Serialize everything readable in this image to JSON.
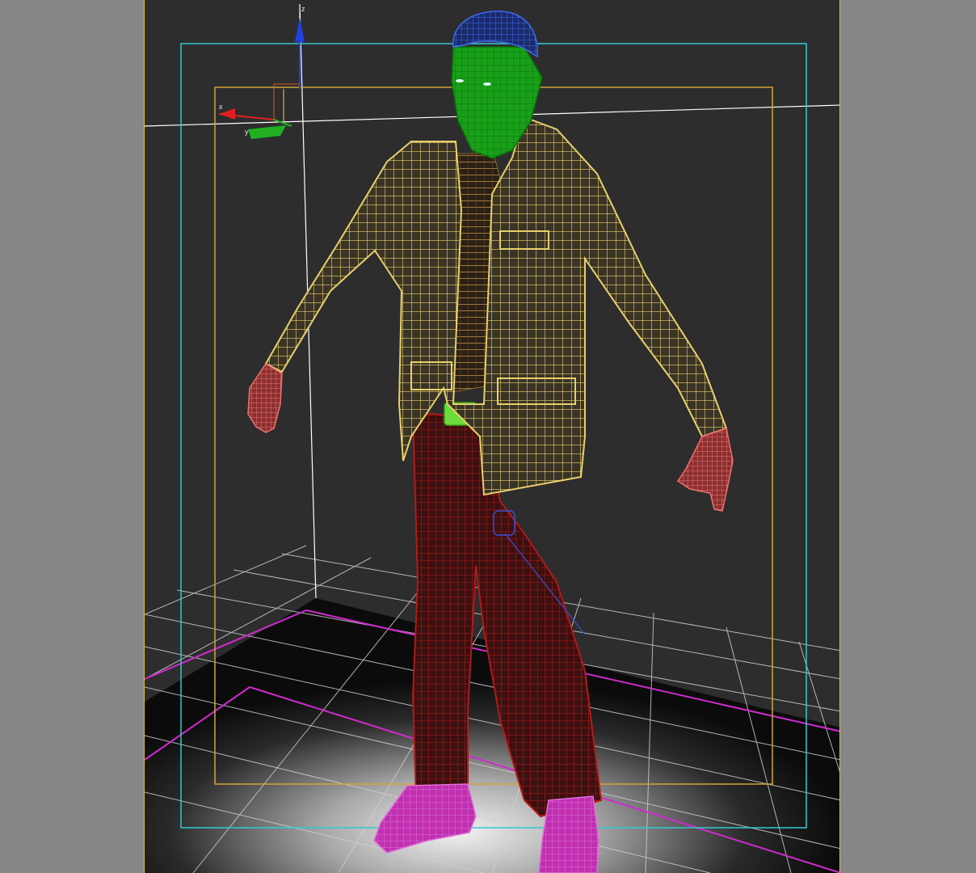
{
  "viewport": {
    "type": "perspective-3d-viewport",
    "content": "character-mesh-wireframe",
    "colors": {
      "background": "#2d2d2d",
      "side_panels": "#878787",
      "safe_frame_outer": "#35c8d0",
      "safe_frame_inner": "#d2a43a",
      "viewport_border": "#d6c23a",
      "grid": "#cfcfcf",
      "ground_plane_edge": "#d02ad0",
      "axis_x": "#e02020",
      "axis_y": "#20b020",
      "axis_z": "#2040e0",
      "head_wire": "#2b55d8",
      "face_fill": "#1a9a1a",
      "jacket_wire": "#e8cf6c",
      "shirt_wire": "#8a6a30",
      "belt_fill": "#6cdc3c",
      "pants_wire": "#b01a1a",
      "hands_wire": "#e86a6a",
      "shoes_fill": "#cc35b8"
    }
  },
  "gizmo": {
    "x_label": "x",
    "y_label": "y",
    "z_label": "z"
  }
}
